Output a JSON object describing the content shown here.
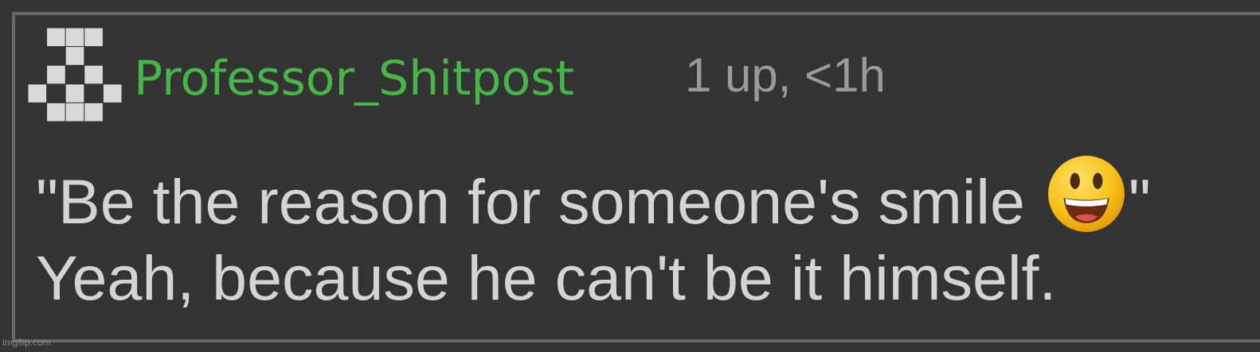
{
  "comment": {
    "username": "Professor_Shitpost",
    "meta": "1 up, <1h",
    "line1_before_emoji": "\"Be the reason for someone's smile ",
    "emoji": "smiling-face-with-open-mouth",
    "line1_after_emoji": "\"",
    "line2": "Yeah, because he can't be it himself."
  },
  "watermark": "imgflip.com",
  "colors": {
    "background": "#333333",
    "border": "#666666",
    "username": "#47b547",
    "meta": "#9a9a9a",
    "body_text": "#d4d4d4",
    "avatar_pixels": "#d9d9d9"
  }
}
